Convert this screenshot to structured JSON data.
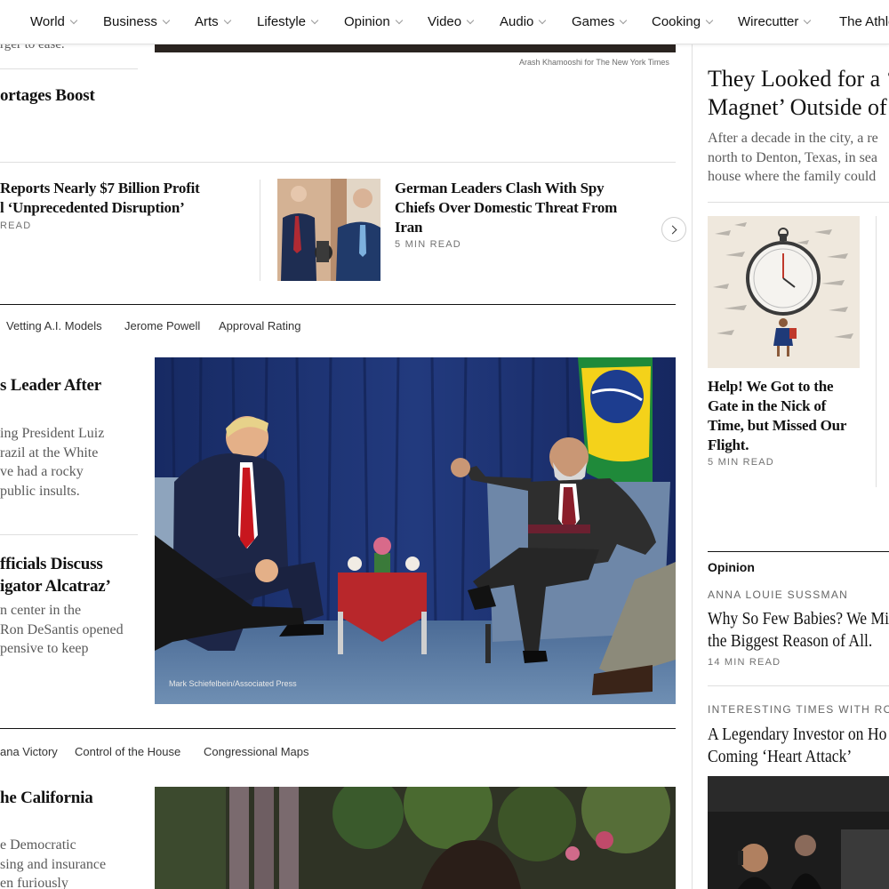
{
  "nav": {
    "items": [
      "World",
      "Business",
      "Arts",
      "Lifestyle",
      "Opinion",
      "Video",
      "Audio",
      "Games",
      "Cooking",
      "Wirecutter",
      "The Athle"
    ]
  },
  "main": {
    "top_fragment": "rger to ease.",
    "top_photo_credit": "Arash Khamooshi for The New York Times",
    "story_shortages": "ortages Boost",
    "carousel": {
      "left_headline_line1": "Reports Nearly $7 Billion Profit",
      "left_headline_line2": "l ‘Unprecedented Disruption’",
      "left_readtime": "READ",
      "right_headline": "German Leaders Clash With Spy Chiefs Over Domestic Threat From Iran",
      "right_readtime": "5 MIN READ"
    },
    "topics1": [
      "Vetting A.I. Models",
      "Jerome Powell",
      "Approval Rating"
    ],
    "lead": {
      "headline": "s Leader After",
      "summary": [
        "ing President Luiz",
        "razil at the White",
        "ve had a rocky",
        "public insults."
      ],
      "photo_credit": "Mark Schiefelbein/Associated Press"
    },
    "second": {
      "headline": [
        "fficials Discuss",
        "igator Alcatraz’"
      ],
      "summary": [
        "n center in the",
        "Ron DeSantis opened",
        "pensive to keep"
      ]
    },
    "topics2": [
      "ana Victory",
      "Control of the House",
      "Congressional Maps"
    ],
    "california": {
      "headline": "he California",
      "summary": [
        "e Democratic",
        "sing and insurance",
        "en furiously"
      ]
    }
  },
  "right": {
    "feature": {
      "headline": [
        "They Looked for a ‘",
        "Magnet’ Outside of"
      ],
      "summary": [
        "After a decade in the city, a re",
        "north to Denton, Texas, in sea",
        "house where the family could"
      ]
    },
    "travel": {
      "headline": "Help! We Got to the Gate in the Nick of Time, but Missed Our Flight.",
      "readtime": "5 MIN READ"
    },
    "opinion": {
      "label": "Opinion",
      "author1": "ANNA LOUIE SUSSMAN",
      "headline1": [
        "Why So Few Babies? We Mi",
        "the Biggest Reason of All."
      ],
      "readtime1": "14 MIN READ",
      "kicker2": "INTERESTING TIMES WITH ROS",
      "headline2": [
        "A Legendary Investor on Ho",
        "Coming ‘Heart Attack’"
      ]
    }
  },
  "colors": {
    "text": "#121212",
    "summary": "#5a5a5a",
    "curtain": "#1c2f6e",
    "rug": "#5f7fa4",
    "tablecloth": "#b8272b",
    "brazil_green": "#1f8a3a",
    "brazil_yellow": "#f4d21a"
  }
}
